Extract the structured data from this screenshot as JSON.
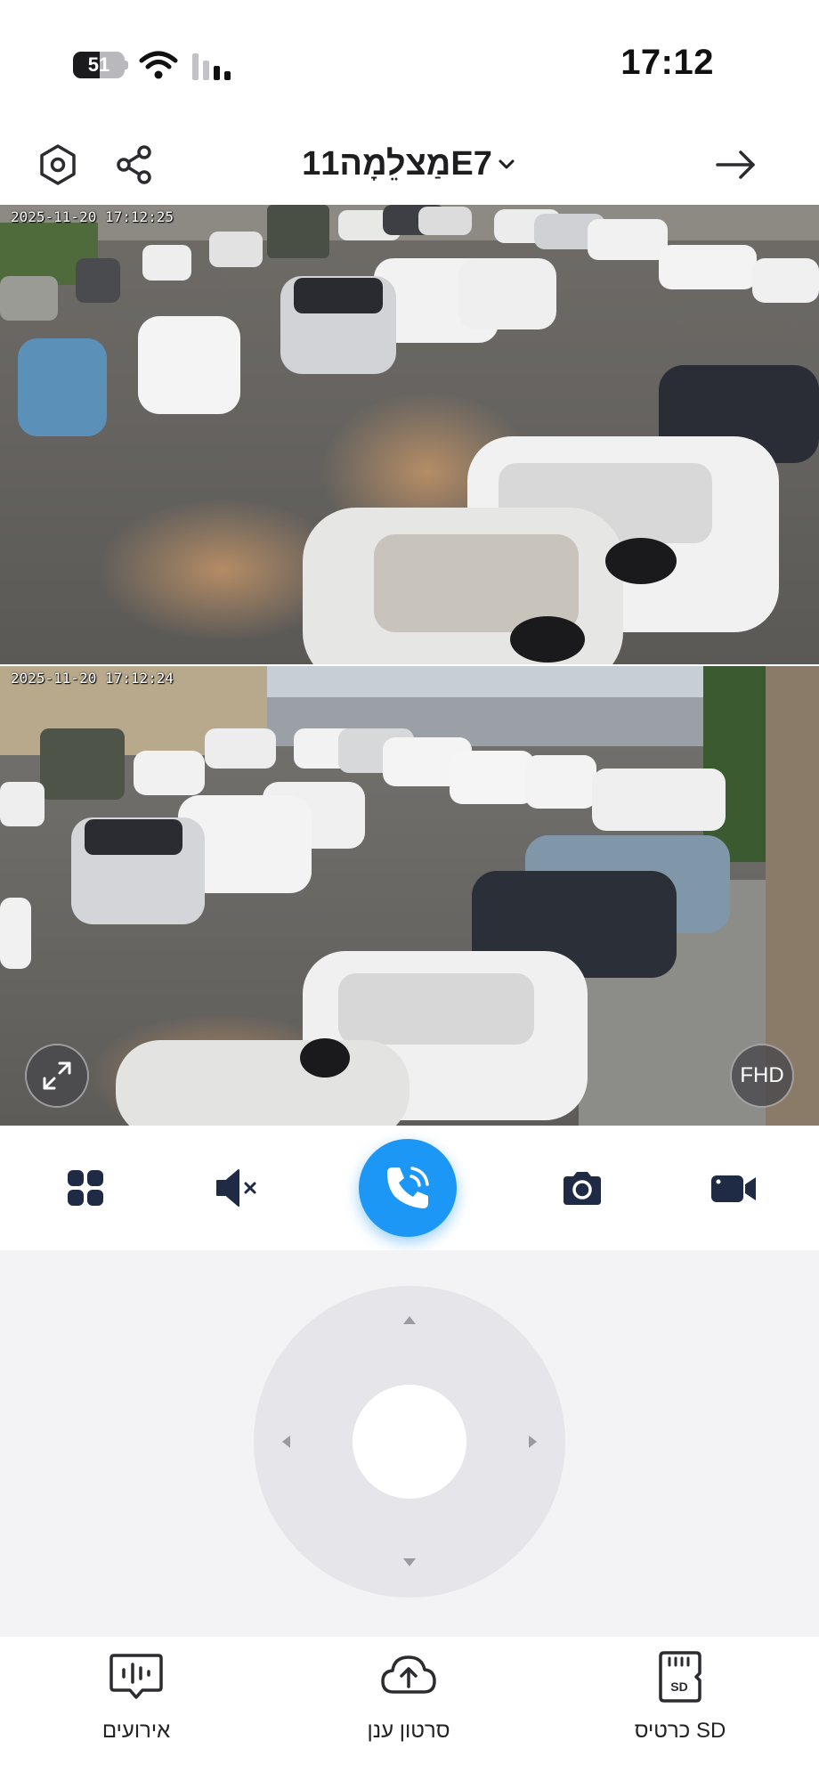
{
  "status_bar": {
    "battery_level": "51",
    "battery_fraction": 0.51,
    "time": "17:12",
    "icons": [
      "battery-icon",
      "wifi-icon",
      "cell-signal-icon"
    ]
  },
  "header": {
    "camera_name": "מַצלֵמָה11E7",
    "icons": [
      "settings-hexagon-icon",
      "share-icon",
      "chevron-down-icon",
      "arrow-right-icon"
    ]
  },
  "feeds": [
    {
      "timestamp": "2025-11-20  17:12:25"
    },
    {
      "timestamp": "2025-11-20  17:12:24"
    }
  ],
  "overlay": {
    "quality_label": "FHD",
    "fullscreen_icon": "expand-icon"
  },
  "controls": {
    "items": [
      "grid-icon",
      "mute-icon",
      "phone-call-icon",
      "camera-icon",
      "video-icon"
    ],
    "accent_color": "#1d97f5"
  },
  "ptz": {
    "arrows": [
      "arrow-up-icon",
      "arrow-down-icon",
      "arrow-left-icon",
      "arrow-right-icon"
    ]
  },
  "bottom_nav": {
    "events_label": "אירועים",
    "cloud_label": "סרטון ענן",
    "sd_label": "כרטיס SD"
  }
}
